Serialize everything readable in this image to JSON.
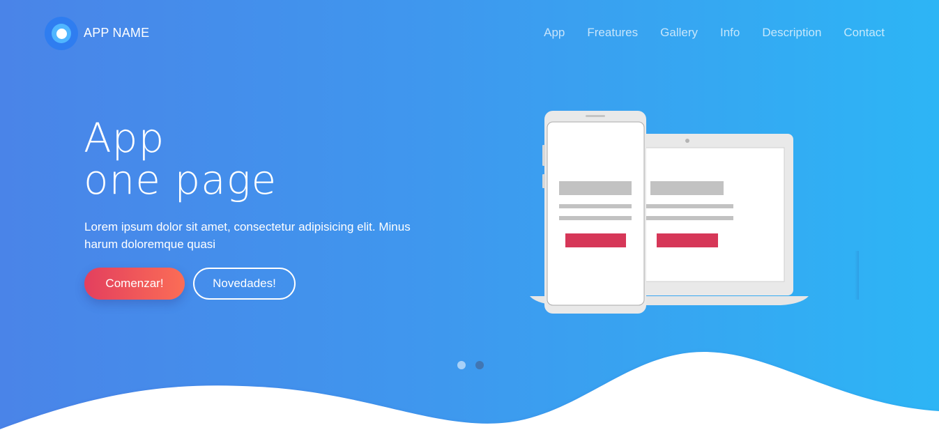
{
  "header": {
    "brand": "APP NAME",
    "nav": [
      "App",
      "Freatures",
      "Gallery",
      "Info",
      "Description",
      "Contact"
    ]
  },
  "hero": {
    "title_line1": "App",
    "title_line2": "one page",
    "lead": "Lorem ipsum dolor sit amet, consectetur adipisicing elit. Minus harum doloremque quasi",
    "primary_button": "Comenzar!",
    "secondary_button": "Novedades!"
  },
  "slider": {
    "slides": 2,
    "active": 1
  },
  "colors": {
    "gradient_start": "#4a84e8",
    "gradient_end": "#2db5f5",
    "accent": "#d63758",
    "button_gradient_end": "#fb6d56"
  },
  "icons": [
    "app-logo-icon"
  ]
}
